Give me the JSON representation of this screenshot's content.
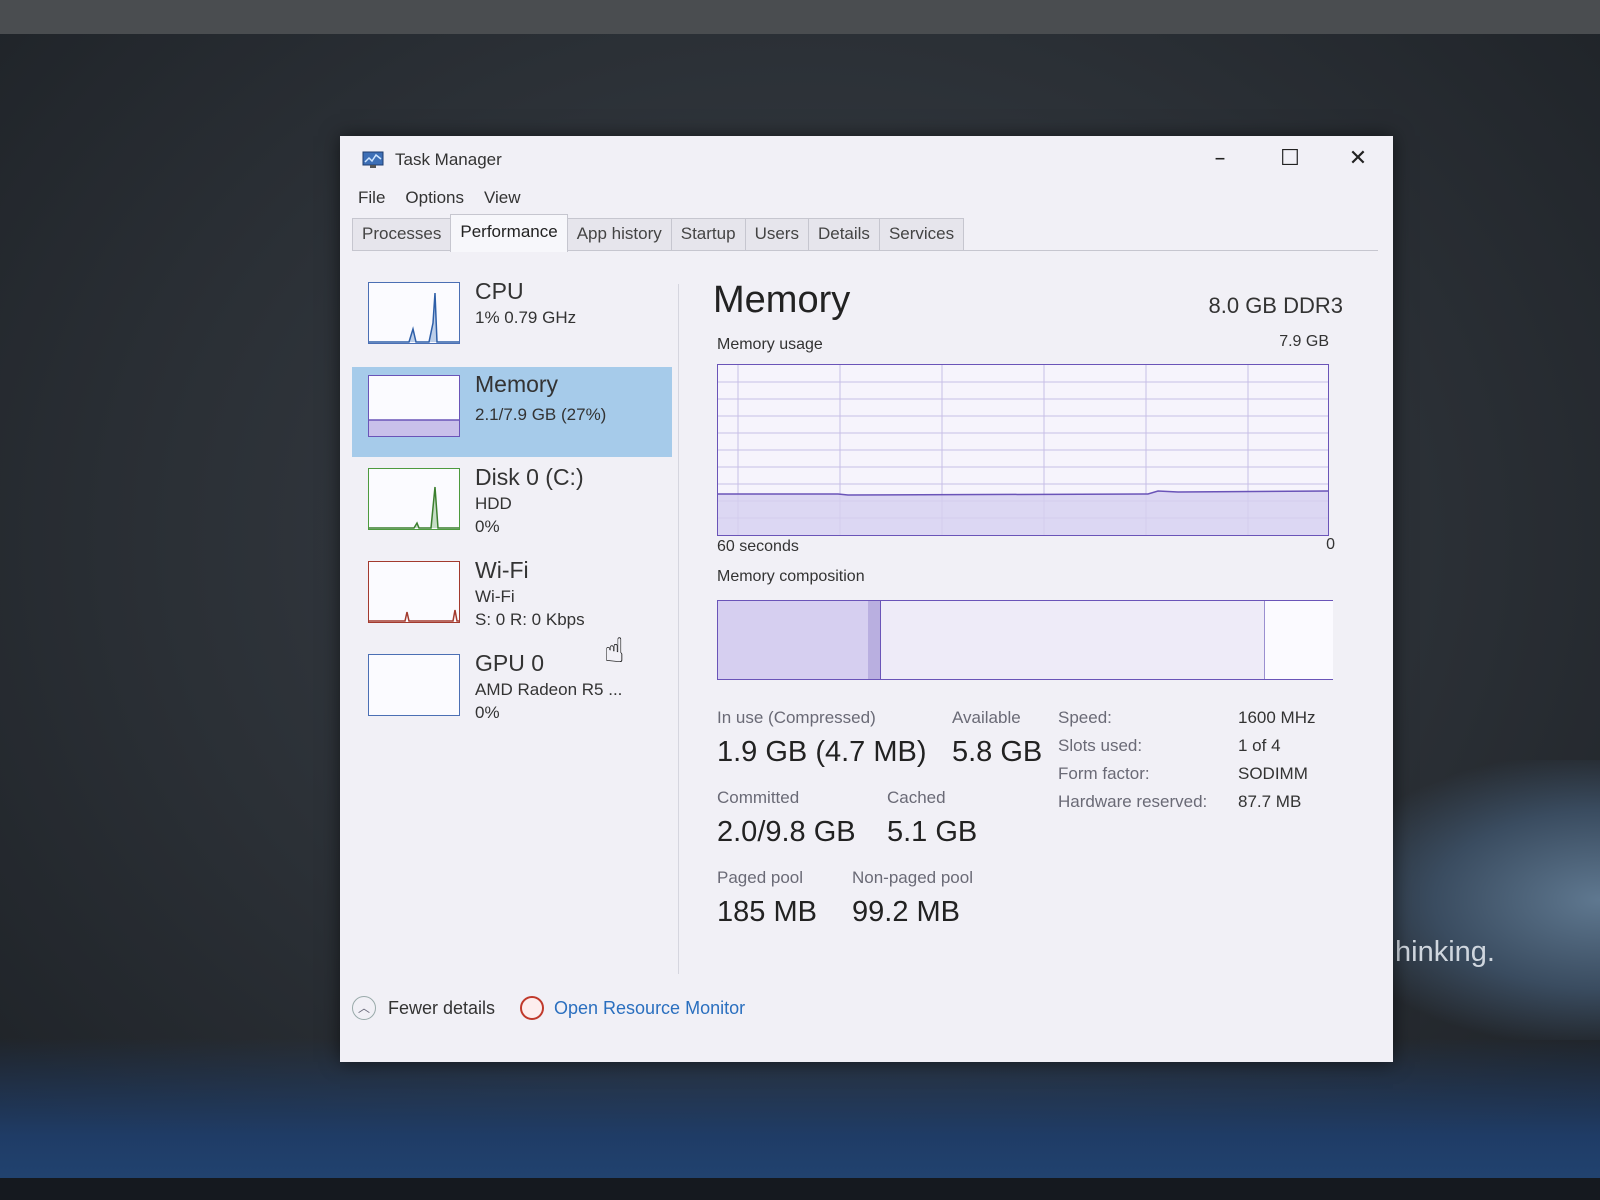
{
  "window": {
    "title": "Task Manager"
  },
  "menu": [
    "File",
    "Options",
    "View"
  ],
  "tabs": [
    "Processes",
    "Performance",
    "App history",
    "Startup",
    "Users",
    "Details",
    "Services"
  ],
  "active_tab": "Performance",
  "resources": [
    {
      "name": "CPU",
      "lines": [
        "1% 0.79 GHz"
      ],
      "color": "#4a7fc1"
    },
    {
      "name": "Memory",
      "lines": [
        "2.1/7.9 GB (27%)"
      ],
      "color": "#7b68b8",
      "selected": true
    },
    {
      "name": "Disk 0 (C:)",
      "lines": [
        "HDD",
        "0%"
      ],
      "color": "#4d9a3e"
    },
    {
      "name": "Wi-Fi",
      "lines": [
        "Wi-Fi",
        "S: 0 R: 0 Kbps"
      ],
      "color": "#a33a2e"
    },
    {
      "name": "GPU 0",
      "lines": [
        "AMD Radeon R5 ...",
        "0%"
      ],
      "color": "#4a7fc1"
    }
  ],
  "memory": {
    "title": "Memory",
    "spec": "8.0 GB DDR3",
    "usage_label": "Memory usage",
    "usage_max": "7.9 GB",
    "axis_left": "60 seconds",
    "axis_right": "0",
    "composition_label": "Memory composition",
    "usage_fraction": 0.27,
    "stats": {
      "in_use_label": "In use (Compressed)",
      "in_use_value": "1.9 GB (4.7 MB)",
      "available_label": "Available",
      "available_value": "5.8 GB",
      "committed_label": "Committed",
      "committed_value": "2.0/9.8 GB",
      "cached_label": "Cached",
      "cached_value": "5.1 GB",
      "paged_label": "Paged pool",
      "paged_value": "185 MB",
      "nonpaged_label": "Non-paged pool",
      "nonpaged_value": "99.2 MB"
    },
    "details": [
      {
        "key": "Speed:",
        "value": "1600 MHz"
      },
      {
        "key": "Slots used:",
        "value": "1 of 4"
      },
      {
        "key": "Form factor:",
        "value": "SODIMM"
      },
      {
        "key": "Hardware reserved:",
        "value": "87.7 MB"
      }
    ]
  },
  "footer": {
    "fewer_details": "Fewer details",
    "open_resource_monitor": "Open Resource Monitor"
  },
  "desktop_text": "hinking.",
  "icons": {
    "app": "task-manager-icon",
    "minimize": "minimize-icon",
    "maximize": "maximize-icon",
    "close": "close-icon",
    "fewer": "chevron-up-icon",
    "monitor": "resource-monitor-icon",
    "cursor": "hand-cursor-icon"
  }
}
